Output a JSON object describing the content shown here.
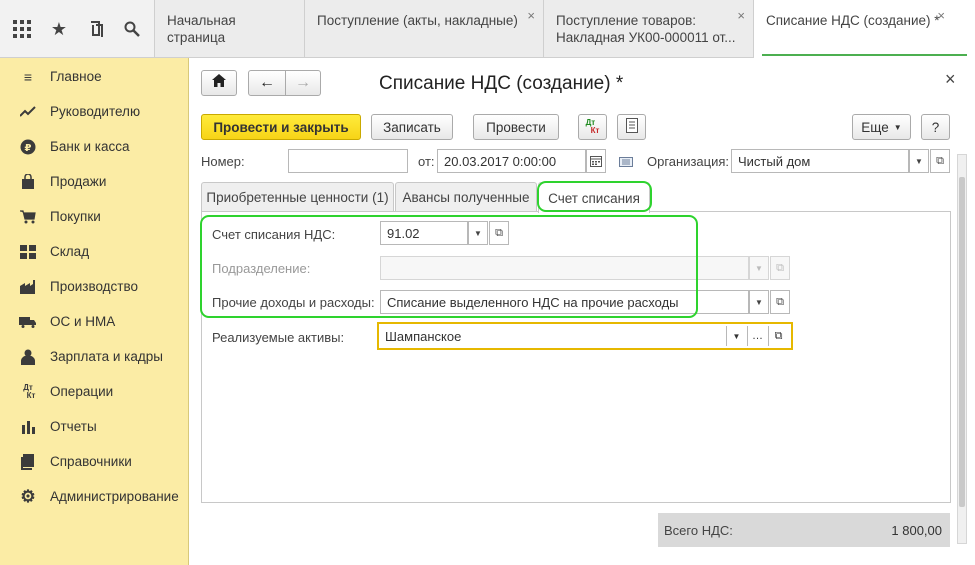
{
  "topbar": {
    "icons": [
      "apps-grid-icon",
      "star-icon",
      "history-icon",
      "search-icon"
    ],
    "tabs": [
      {
        "label": "Начальная страница"
      },
      {
        "label": "Поступление (акты, накладные)",
        "close": "×"
      },
      {
        "label_line1": "Поступление товаров:",
        "label_line2": "Накладная УК00-000011 от...",
        "close": "×"
      },
      {
        "label": "Списание НДС (создание) *",
        "close": "×"
      }
    ]
  },
  "sidebar": {
    "items": [
      {
        "label": "Главное",
        "icon": "menu-lines-icon"
      },
      {
        "label": "Руководителю",
        "icon": "trend-icon"
      },
      {
        "label": "Банк и касса",
        "icon": "ruble-icon"
      },
      {
        "label": "Продажи",
        "icon": "bag-icon"
      },
      {
        "label": "Покупки",
        "icon": "cart-icon"
      },
      {
        "label": "Склад",
        "icon": "warehouse-icon"
      },
      {
        "label": "Производство",
        "icon": "factory-icon"
      },
      {
        "label": "ОС и НМА",
        "icon": "truck-icon"
      },
      {
        "label": "Зарплата и кадры",
        "icon": "person-icon"
      },
      {
        "label": "Операции",
        "icon": "dt-kt-icon"
      },
      {
        "label": "Отчеты",
        "icon": "bar-chart-icon"
      },
      {
        "label": "Справочники",
        "icon": "book-icon"
      },
      {
        "label": "Администрирование",
        "icon": "gear-icon"
      }
    ]
  },
  "form": {
    "title": "Списание НДС (создание) *",
    "close": "×",
    "nav": {
      "home": "⌂",
      "back": "←",
      "forward": "→"
    },
    "toolbar": {
      "post_close": "Провести и закрыть",
      "save": "Записать",
      "post": "Провести",
      "dtkt_top": "Дт",
      "dtkt_bottom": "Кт",
      "more": "Еще",
      "help": "?"
    },
    "number_label": "Номер:",
    "number_value": "",
    "date_label": "от:",
    "date_value": "20.03.2017  0:00:00",
    "org_label": "Организация:",
    "org_value": "Чистый дом",
    "tabs": [
      {
        "label": "Приобретенные ценности (1)"
      },
      {
        "label": "Авансы полученные"
      },
      {
        "label": "Счет списания"
      }
    ],
    "account_label": "Счет списания НДС:",
    "account_value": "91.02",
    "division_label": "Подразделение:",
    "division_value": "",
    "other_label": "Прочие доходы и расходы:",
    "other_value": "Списание выделенного НДС на прочие расходы",
    "assets_label": "Реализуемые активы:",
    "assets_value": "Шампанское",
    "total_label": "Всего НДС:",
    "total_value": "1 800,00"
  },
  "colors": {
    "sidebar_bg": "#fbeca5",
    "primary_button": "#f7d417",
    "highlight_green": "#2ed32e",
    "focus_orange": "#e6b800"
  }
}
